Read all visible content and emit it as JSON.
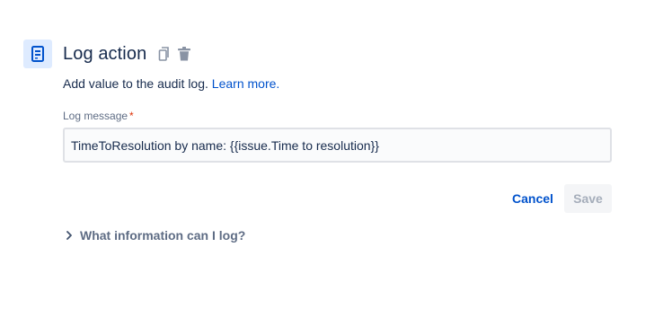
{
  "header": {
    "title": "Log action",
    "icon": "log-document-icon",
    "actions": [
      {
        "icon": "copy-icon"
      },
      {
        "icon": "trash-icon"
      }
    ]
  },
  "description": {
    "text": "Add value to the audit log.",
    "link_text": "Learn more."
  },
  "log_message": {
    "label": "Log message",
    "required_marker": "*",
    "value": "TimeToResolution by name: {{issue.Time to resolution}}"
  },
  "buttons": {
    "cancel_label": "Cancel",
    "save_label": "Save",
    "save_enabled": false
  },
  "expander": {
    "label": "What information can I log?",
    "expanded": false
  },
  "colors": {
    "icon_bg": "#deebff",
    "icon_fg": "#0052cc",
    "link": "#0052cc",
    "required": "#de350b",
    "muted": "#5e6c84"
  }
}
